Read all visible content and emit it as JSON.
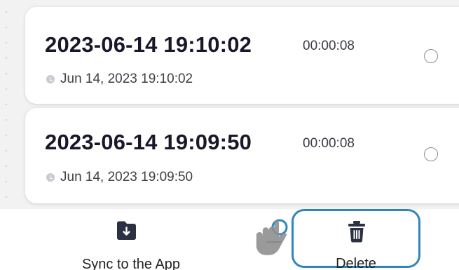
{
  "recordings": [
    {
      "title": "2023-06-14 19:10:02",
      "duration": "00:00:08",
      "date": "Jun 14, 2023 19:10:02",
      "icon": "clock-icon"
    },
    {
      "title": "2023-06-14 19:09:50",
      "duration": "00:00:08",
      "date": "Jun 14, 2023 19:09:50",
      "icon": "clock-icon"
    }
  ],
  "actions": {
    "sync_label": "Sync to the App",
    "sync_icon": "download-folder-icon",
    "delete_label": "Delete",
    "delete_icon": "trash-icon"
  },
  "colors": {
    "title": "#18182a",
    "icon_dark": "#2b3142",
    "highlight": "#2f86be",
    "background": "#f2f2f2",
    "card": "#ffffff"
  },
  "pointer_icon": "hand-pointer-icon"
}
